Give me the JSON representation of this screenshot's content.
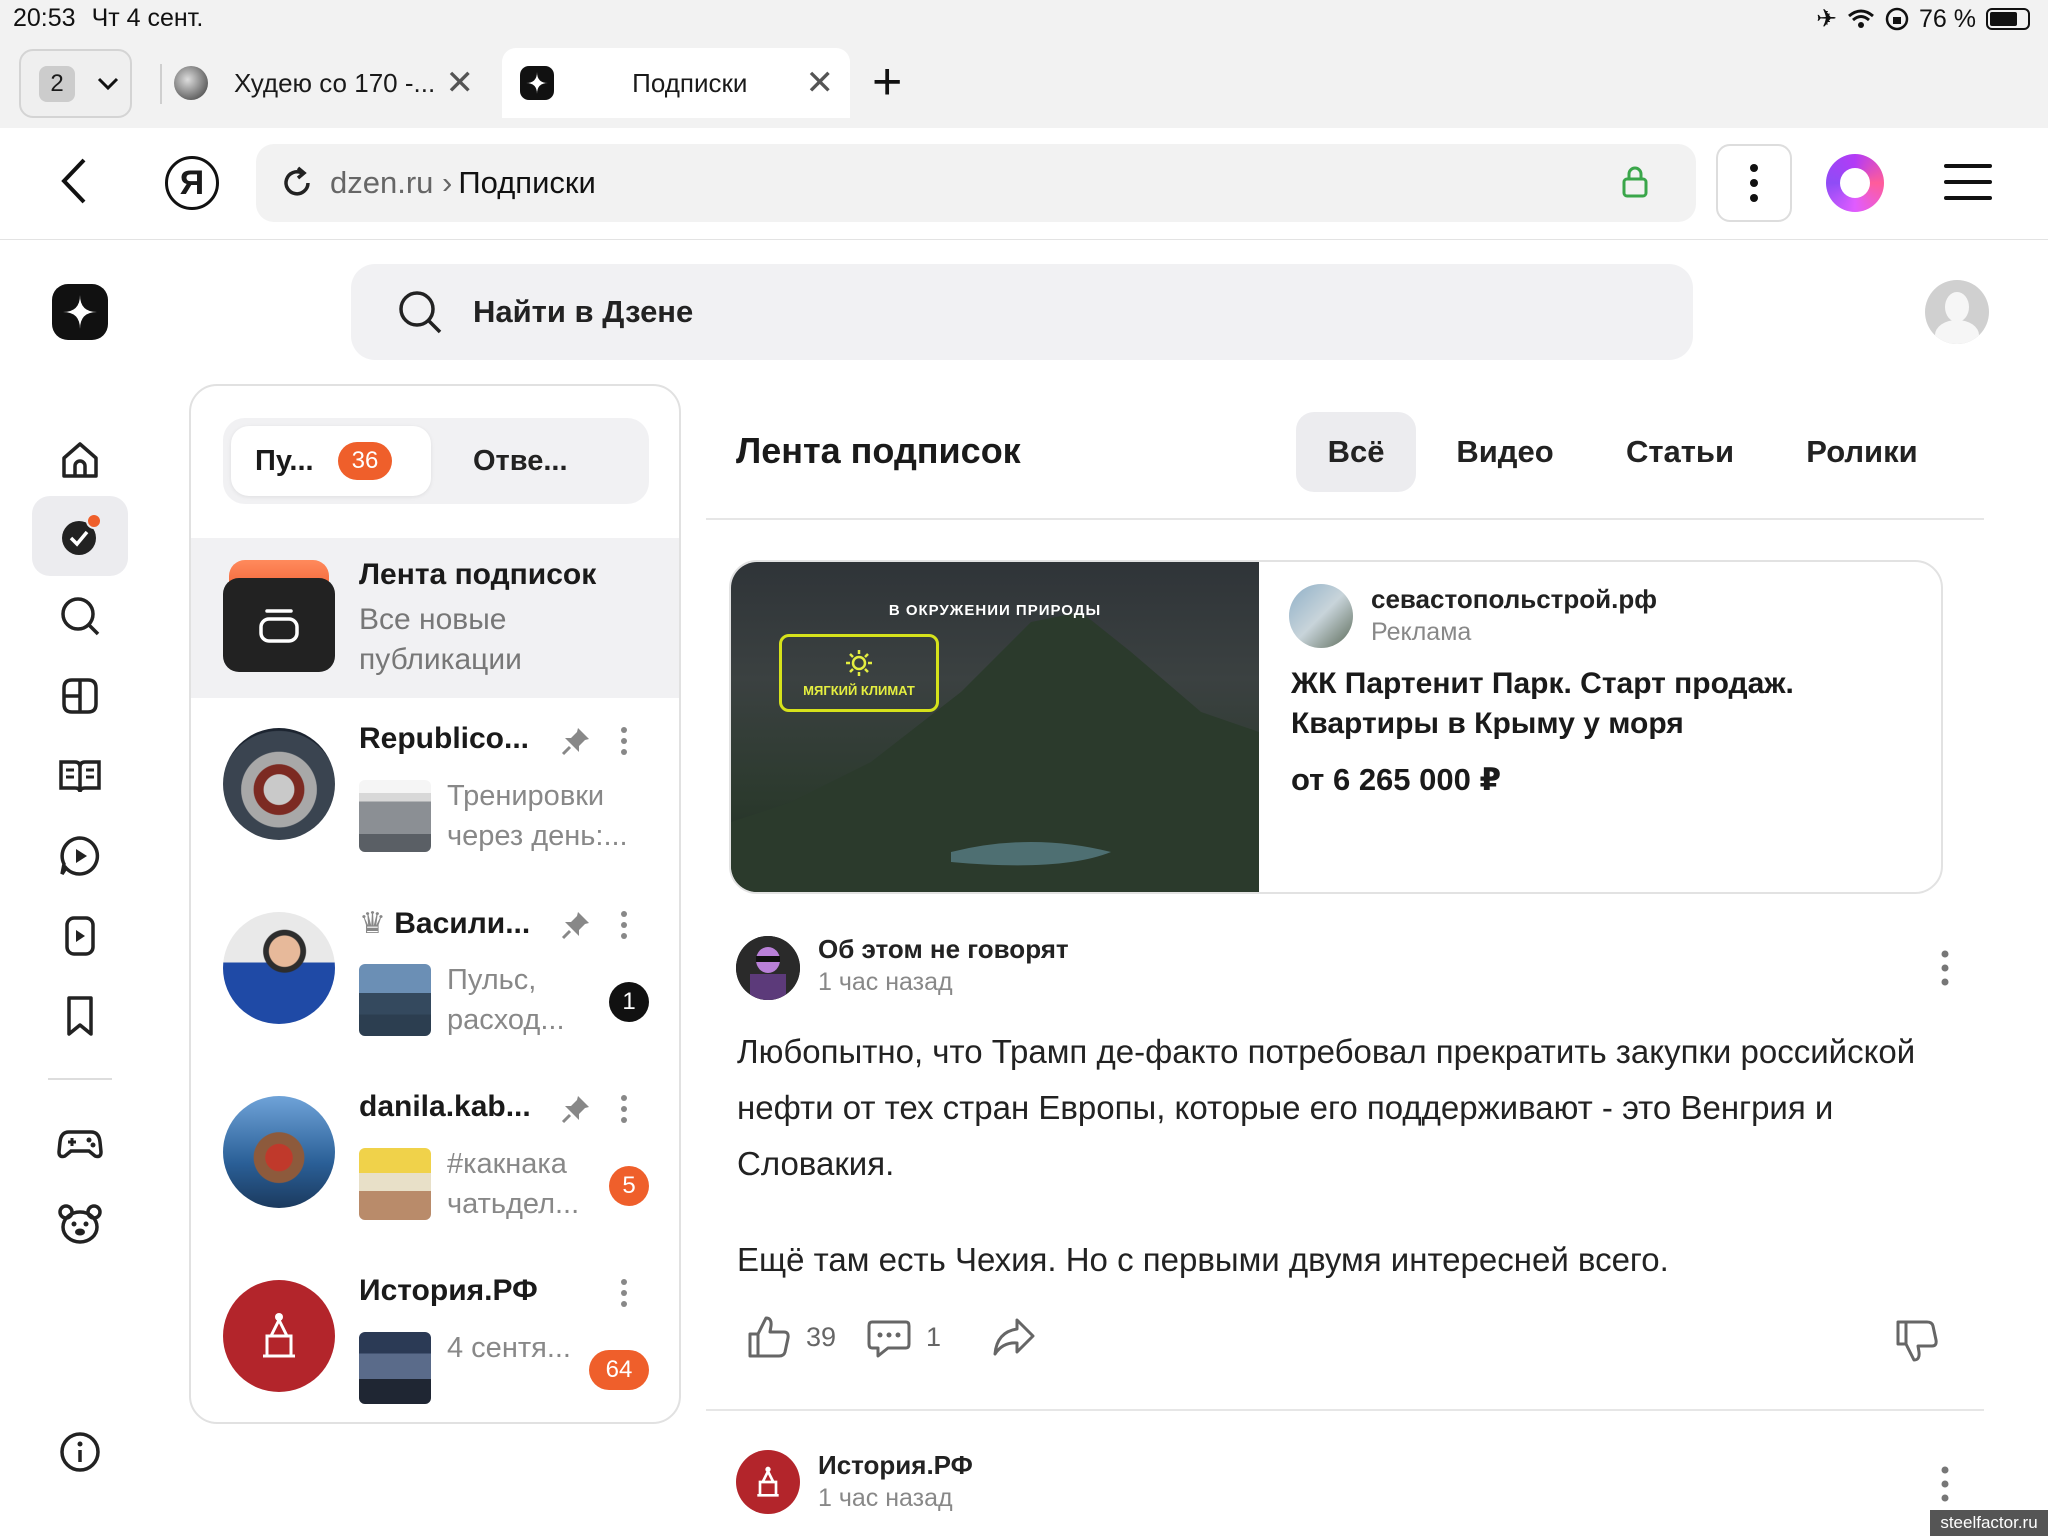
{
  "status_bar": {
    "time": "20:53",
    "date": "Чт 4 сент.",
    "battery": "76 %",
    "battery_level": 0.76
  },
  "tabs": {
    "count": "2",
    "items": [
      {
        "title": "Худею со 170 -...",
        "active": false
      },
      {
        "title": "Подписки",
        "active": true
      }
    ]
  },
  "address": {
    "host": "dzen.ru",
    "separator": "›",
    "path": "Подписки"
  },
  "search": {
    "placeholder": "Найти в Дзене"
  },
  "panel": {
    "segment_left": "Пу...",
    "segment_left_badge": "36",
    "segment_right": "Отве...",
    "feed_item": {
      "title": "Лента подписок",
      "subtitle": "Все новые публикации"
    },
    "channels": [
      {
        "name": "Republico...",
        "preview": "Тренировки через день:...",
        "pinned": true,
        "count": ""
      },
      {
        "name": "Васили...",
        "crown": "♛",
        "preview": "Пульс, расход...",
        "pinned": true,
        "count": "1"
      },
      {
        "name": "danila.kab...",
        "preview": "#какнака чатьдел...",
        "pinned": true,
        "count": "5"
      },
      {
        "name": "История.РФ",
        "preview": "4 сентя...",
        "pinned": false,
        "count": "64"
      }
    ]
  },
  "feed": {
    "title": "Лента подписок",
    "filters": [
      "Всё",
      "Видео",
      "Статьи",
      "Ролики"
    ],
    "active_filter": "Всё"
  },
  "ad": {
    "image_caption": "В ОКРУЖЕНИИ ПРИРОДЫ",
    "image_badge": "МЯГКИЙ КЛИМАТ",
    "source": "севастопольстрой.рф",
    "label": "Реклама",
    "title": "ЖК Партенит Парк. Старт продаж. Квартиры в Крыму у моря",
    "price": "от 6 265 000 ₽"
  },
  "post": {
    "author": "Об этом не говорят",
    "time": "1 час назад",
    "paragraph_1": "Любопытно, что Трамп де-факто потребовал прекратить закупки российской нефти от тех стран Европы, которые его поддерживают - это Венгрия и Словакия.",
    "paragraph_2": "Ещё там есть Чехия. Но с первыми двумя интересней всего.",
    "likes": "39",
    "comments": "1"
  },
  "post_2": {
    "author": "История.РФ",
    "time": "1 час назад"
  },
  "watermark": "steelfactor.ru",
  "colors": {
    "accent": "#ef5f2b",
    "alice_gradient": "#b33bf6",
    "lock_green": "#3aa64a"
  }
}
